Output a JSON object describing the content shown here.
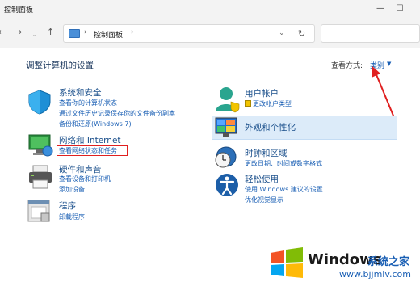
{
  "window": {
    "title": "控制面板",
    "minimize_glyph": "—",
    "maximize_glyph": "☐"
  },
  "nav": {
    "back_glyph": "←",
    "forward_glyph": "→",
    "up_glyph": "↑",
    "address_sep": "›",
    "address_crumb": "控制面板",
    "address_crumb_sep": "›",
    "dropdown_glyph": "⌄",
    "refresh_glyph": "↻"
  },
  "header": {
    "title": "调整计算机的设置",
    "view_by_label": "查看方式:",
    "view_by_value": "类别"
  },
  "left_categories": [
    {
      "title": "系统和安全",
      "links": [
        "查看你的计算机状态",
        "通过文件历史记录保存你的文件备份副本",
        "备份和还原(Windows 7)"
      ]
    },
    {
      "title": "网络和 Internet",
      "links": [
        "查看网络状态和任务"
      ]
    },
    {
      "title": "硬件和声音",
      "links": [
        "查看设备和打印机",
        "添加设备"
      ]
    },
    {
      "title": "程序",
      "links": [
        "卸载程序"
      ]
    }
  ],
  "right_categories": [
    {
      "title": "用户帐户",
      "links": [
        "更改帐户类型"
      ]
    },
    {
      "title": "外观和个性化",
      "links": []
    },
    {
      "title": "时钟和区域",
      "links": [
        "更改日期、时间或数字格式"
      ]
    },
    {
      "title": "轻松使用",
      "links": [
        "使用 Windows 建议的设置",
        "优化视觉显示"
      ]
    }
  ],
  "watermark": {
    "brand": "Windows",
    "suffix": "系统之家",
    "url": "www.bjjmlv.com"
  },
  "colors": {
    "accent": "#1a5fb4",
    "highlight": "#dcebf9",
    "annotation_red": "#e02020"
  }
}
